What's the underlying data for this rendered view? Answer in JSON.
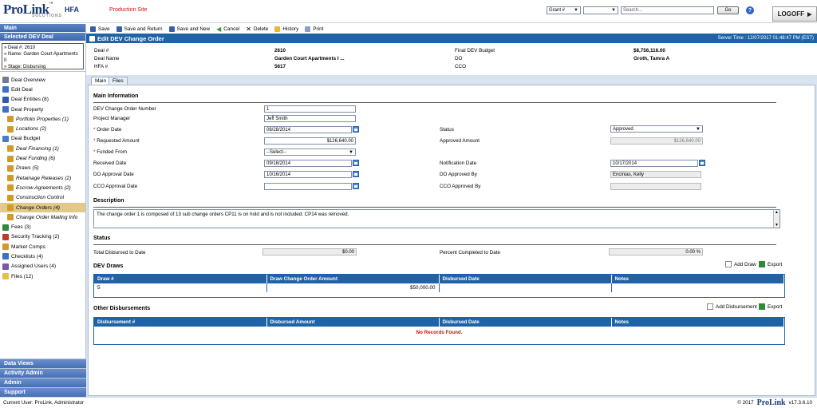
{
  "app": {
    "logo_text": "ProLink",
    "logo_sub": "SOLUTIONS",
    "logo_tm": "™",
    "product": "HFA",
    "site": "Production Site"
  },
  "topnav": {
    "search_type": "Grant #",
    "search_type2": "",
    "search_value": "",
    "search_placeholder": "Search...",
    "go_label": "Go",
    "help_label": "?",
    "logoff_label": "LOGOFF"
  },
  "toolbar": {
    "save": "Save",
    "save_return": "Save and Return",
    "save_new": "Save and New",
    "cancel": "Cancel",
    "delete": "Delete",
    "history": "History",
    "print": "Print"
  },
  "titlebar": {
    "title": "Edit DEV Change Order",
    "server_time": "Server Time : 12/07/2017 01:48:47 PM (EST)"
  },
  "header": {
    "deal_num_label": "Deal #",
    "deal_num": "2610",
    "deal_name_label": "Deal Name",
    "deal_name": "Garden Court Apartments I ...",
    "hfa_label": "HFA #",
    "hfa": "5617",
    "final_budget_label": "Final DEV Budget",
    "final_budget": "$8,756,116.00",
    "do_label": "DO",
    "do": "Groth, Tamra A",
    "cco_label": "CCO",
    "cco": ""
  },
  "sidebar": {
    "main": "Main",
    "selected": "Selected DEV Deal",
    "deal_info": [
      "» Deal #: 2610",
      "» Name: Garden Court Apartments II",
      "» Stage: Disbursing"
    ],
    "items": [
      {
        "label": "Deal Overview",
        "sub": false,
        "active": false,
        "color": "#6f7c94"
      },
      {
        "label": "Edit Deal",
        "sub": false,
        "active": false,
        "color": "#3a73c4"
      },
      {
        "label": "Deal Entities (8)",
        "sub": false,
        "active": false,
        "color": "#2a5ea8"
      },
      {
        "label": "Deal Property",
        "sub": false,
        "active": false,
        "color": "#3a73c4"
      },
      {
        "label": "Portfolio Properties (1)",
        "sub": true,
        "active": false,
        "color": "#d39a2a"
      },
      {
        "label": "Locations (2)",
        "sub": true,
        "active": false,
        "color": "#d39a2a"
      },
      {
        "label": "Deal Budget",
        "sub": false,
        "active": false,
        "color": "#4a7cc4"
      },
      {
        "label": "Deal Financing (1)",
        "sub": true,
        "active": false,
        "color": "#d39a2a"
      },
      {
        "label": "Deal Funding (6)",
        "sub": true,
        "active": false,
        "color": "#d39a2a"
      },
      {
        "label": "Draws (5)",
        "sub": true,
        "active": false,
        "color": "#d39a2a"
      },
      {
        "label": "Retainage Releases (2)",
        "sub": true,
        "active": false,
        "color": "#d39a2a"
      },
      {
        "label": "Escrow Agreements (2)",
        "sub": true,
        "active": false,
        "color": "#d39a2a"
      },
      {
        "label": "Construction Control",
        "sub": true,
        "active": false,
        "color": "#d39a2a"
      },
      {
        "label": "Change Orders (4)",
        "sub": true,
        "active": true,
        "color": "#d39a2a"
      },
      {
        "label": "Change Order Mailing Info",
        "sub": true,
        "active": false,
        "color": "#d39a2a"
      },
      {
        "label": "Fees (3)",
        "sub": false,
        "active": false,
        "color": "#2e8b3a"
      },
      {
        "label": "Security Tracking (2)",
        "sub": false,
        "active": false,
        "color": "#c0392b"
      },
      {
        "label": "Market Comps",
        "sub": false,
        "active": false,
        "color": "#d39a2a"
      },
      {
        "label": "Checklists (4)",
        "sub": false,
        "active": false,
        "color": "#3a73c4"
      },
      {
        "label": "Assigned Users (4)",
        "sub": false,
        "active": false,
        "color": "#7a5aa8"
      },
      {
        "label": "Files (12)",
        "sub": false,
        "active": false,
        "color": "#e3c14a"
      }
    ],
    "bottom": [
      "Data Views",
      "Activity Admin",
      "Admin",
      "Support"
    ]
  },
  "tabs": [
    "Main",
    "Files"
  ],
  "form": {
    "main_info": "Main Information",
    "co_number_label": "DEV Change Order Number",
    "co_number": "1",
    "pm_label": "Project Manager",
    "pm": "Jeff Smith",
    "order_date_label": "Order Date",
    "order_date": "08/28/2014",
    "status_label": "Status",
    "status": "Approved",
    "requested_label": "Requested Amount",
    "requested": "$126,640.00",
    "approved_amount_label": "Approved Amount",
    "approved_amount": "$126,640.00",
    "funded_from_label": "Funded From",
    "funded_from": "--Select--",
    "received_label": "Received Date",
    "received": "09/18/2014",
    "notification_label": "Notification Date",
    "notification": "10/17/2014",
    "do_approval_label": "DO Approval Date",
    "do_approval": "10/16/2014",
    "do_approved_by_label": "DO Approved By",
    "do_approved_by": "Encinias, Kelly",
    "cco_approval_label": "CCO Approval Date",
    "cco_approval": "",
    "cco_approved_by_label": "CCO Approved By",
    "cco_approved_by": "",
    "req_mark": "*",
    "description_title": "Description",
    "description": "The change order 1 is composed of 13 sub change orders CP11 is on hold and is not included.  CP14 was removed.",
    "status_title": "Status",
    "total_disbursed_label": "Total Disbursed to Date",
    "total_disbursed": "$0.00",
    "pct_complete_label": "Percent Completed to Date",
    "pct_complete": "0.00 %"
  },
  "dev_draws": {
    "title": "DEV Draws",
    "add_label": "Add Draw",
    "export_label": "Export",
    "columns": [
      "Draw #",
      "Draw Change Order Amount",
      "Disbursed Date",
      "Notes"
    ],
    "rows": [
      [
        "5",
        "$50,000.00",
        "",
        ""
      ]
    ]
  },
  "other_disb": {
    "title": "Other Disbursements",
    "add_label": "Add Disbursement",
    "export_label": "Export",
    "columns": [
      "Disbursement #",
      "Disbursed Amount",
      "Disbursed Date",
      "Notes"
    ],
    "empty": "No Records Found."
  },
  "footer": {
    "user": "Current User: ProLink, Administrator",
    "copyright": "© 2017",
    "brand": "ProLink",
    "version": "v17.3.6.10"
  }
}
